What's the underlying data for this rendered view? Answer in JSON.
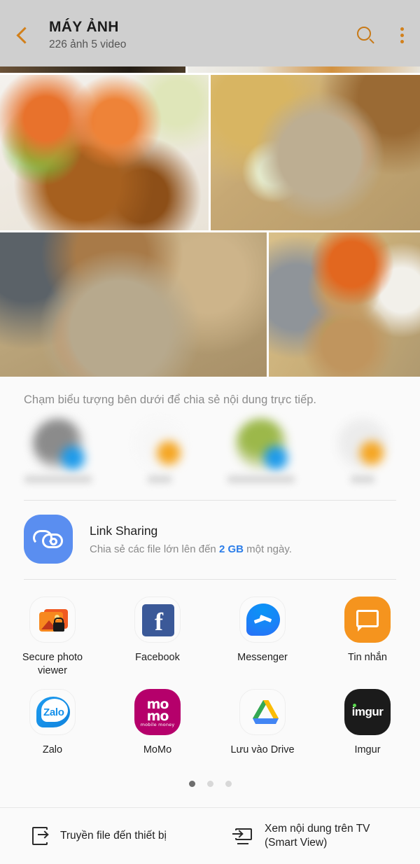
{
  "header": {
    "back_icon": "back-chevron-icon",
    "title": "MÁY ẢNH",
    "subtitle": "226 ảnh  5 video",
    "search_icon": "search-icon",
    "more_icon": "more-vertical-icon",
    "accent_color": "#d2801b",
    "background_color": "#cfcfcf"
  },
  "photo_grid": {
    "rows": [
      {
        "cells": [
          {
            "name": "photo-thumb-partial-1"
          },
          {
            "name": "photo-thumb-partial-2"
          }
        ]
      },
      {
        "cells": [
          {
            "name": "photo-thumb-crab-plate"
          },
          {
            "name": "photo-thumb-crab-claypot"
          }
        ]
      },
      {
        "cells": [
          {
            "name": "photo-thumb-crab-table"
          },
          {
            "name": "photo-thumb-crab-pots"
          }
        ]
      }
    ]
  },
  "share_sheet": {
    "hint": "Chạm biểu tượng bên dưới để chia sẻ nội dung trực tiếp.",
    "direct_share": [
      {
        "name": "direct-share-contact-1",
        "blurred": true
      },
      {
        "name": "direct-share-contact-2",
        "blurred": true
      },
      {
        "name": "direct-share-contact-3",
        "blurred": true
      },
      {
        "name": "direct-share-contact-4",
        "blurred": true
      }
    ],
    "link_sharing": {
      "icon": "link-sharing-cloud-icon",
      "title": "Link Sharing",
      "subtitle_before": "Chia sẻ các file lớn lên đến ",
      "subtitle_highlight": "2 GB",
      "subtitle_after": " một ngày.",
      "highlight_color": "#2b7de9",
      "icon_color": "#5a8ef0"
    },
    "apps": [
      [
        {
          "label": "Secure photo viewer",
          "icon": "secure-photo-viewer-icon"
        },
        {
          "label": "Facebook",
          "icon": "facebook-icon"
        },
        {
          "label": "Messenger",
          "icon": "messenger-icon"
        },
        {
          "label": "Tin nhắn",
          "icon": "messages-icon"
        }
      ],
      [
        {
          "label": "Zalo",
          "icon": "zalo-icon"
        },
        {
          "label": "MoMo",
          "icon": "momo-icon",
          "wordmark_line1": "mo",
          "wordmark_line2": "mo",
          "wordmark_line3": "mobile money"
        },
        {
          "label": "Lưu vào Drive",
          "icon": "google-drive-icon"
        },
        {
          "label": "Imgur",
          "icon": "imgur-icon",
          "wordmark": "imgur"
        }
      ]
    ],
    "pagination": {
      "total": 3,
      "active_index": 0
    }
  },
  "bottom_bar": {
    "items": [
      {
        "label": "Truyền file đến thiết bị",
        "icon": "transfer-file-icon"
      },
      {
        "label": "Xem nội dung trên TV\n(Smart View)",
        "icon": "smart-view-tv-icon"
      }
    ]
  }
}
